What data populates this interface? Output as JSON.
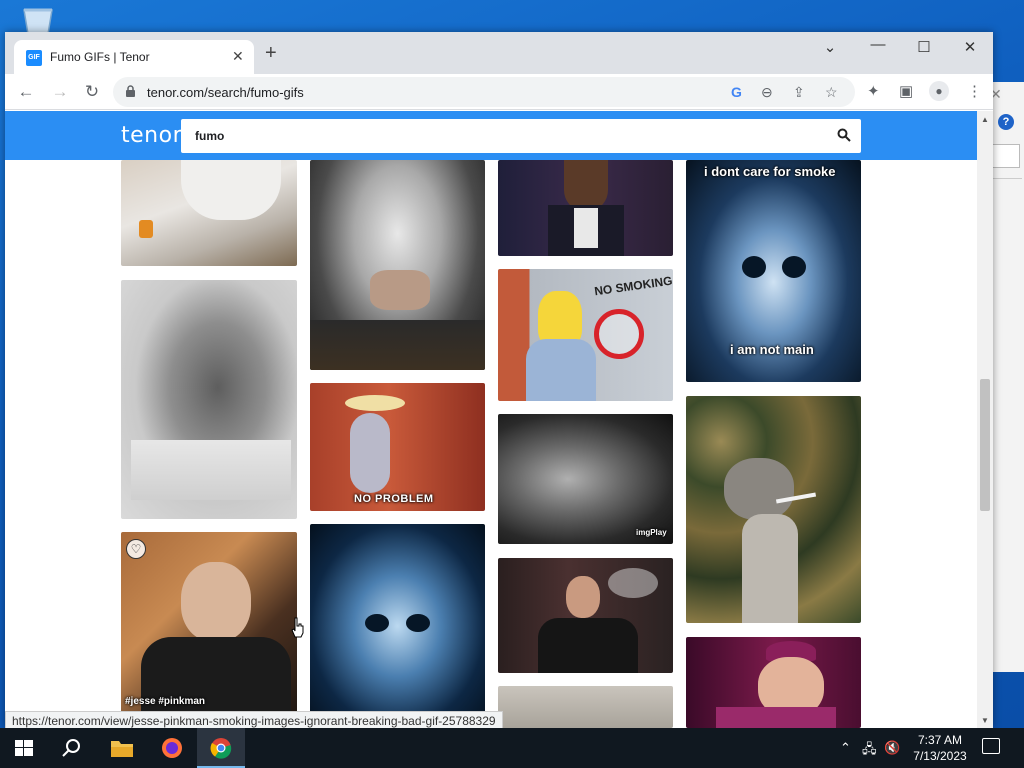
{
  "browser": {
    "tab_title": "Fumo GIFs | Tenor",
    "favicon_text": "GIF",
    "url": "tenor.com/search/fumo-gifs"
  },
  "tenor": {
    "logo": "tenor",
    "search_value": "fumo"
  },
  "gifs": {
    "skull_top_caption_top": "i dont care for smoke",
    "skull_top_caption_bottom": "i am not main",
    "no_smoking_sign": "NO SMOKING",
    "no_problem_caption": "NO PROBLEM",
    "imgplay_watermark": "imgPlay",
    "jesse_tags": "#jesse  #pinkman"
  },
  "status_url": "https://tenor.com/view/jesse-pinkman-smoking-images-ignorant-breaking-bad-gif-25788329",
  "taskbar": {
    "time": "7:37 AM",
    "date": "7/13/2023"
  },
  "colors": {
    "tenor_blue": "#2b8ef3",
    "taskbar": "#101820"
  }
}
